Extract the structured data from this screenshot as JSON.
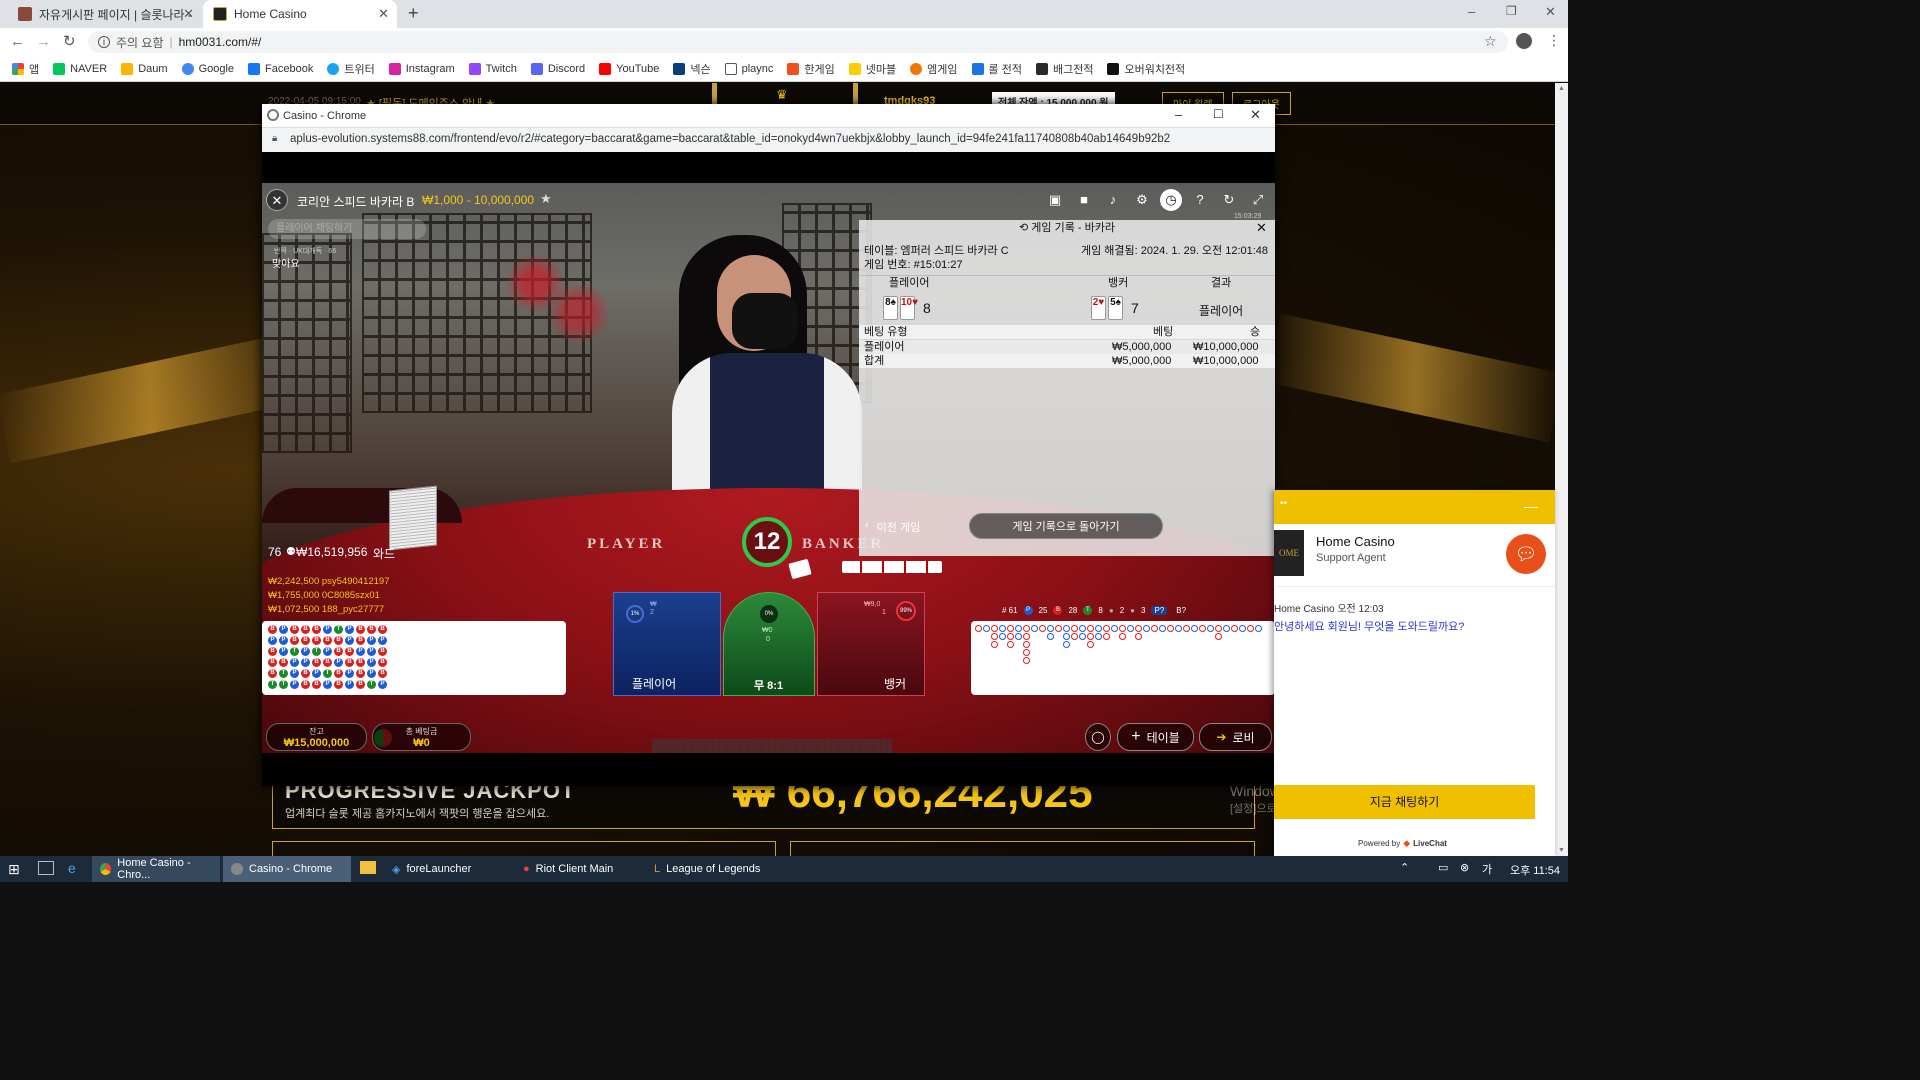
{
  "browser": {
    "tabs": [
      {
        "label": "자유게시판 페이지 | 슬롯나라 -",
        "active": false
      },
      {
        "label": "Home Casino",
        "active": true
      }
    ],
    "new_tab_glyph": "+",
    "address": {
      "warning": "주의 요함",
      "url": "hm0031.com/#/"
    },
    "bookmarks": [
      "앱",
      "NAVER",
      "Daum",
      "Google",
      "Facebook",
      "트위터",
      "Instagram",
      "Twitch",
      "Discord",
      "YouTube",
      "넥슨",
      "plaync",
      "한게임",
      "넷마블",
      "엠게임",
      "롤 전적",
      "배그전적",
      "오버워치전적"
    ]
  },
  "site_background": {
    "top_left_text": "2022-04-05 09:15:00",
    "notice": "★ [필독] 도메인주소 안내 ★",
    "user": "tmdgks93",
    "balance_label": "전체 잔액 : 15,000,000 원",
    "button1": "마이 월렛",
    "button2": "로그아웃",
    "banner_title": "PROGRESSIVE JACKPOT",
    "banner_sub": "업계최다 슬롯 제공 홈카지노에서 잭팟의 행운을 잡으세요.",
    "jackpot_value": "₩ 66,766,242,025",
    "watermark": "Windows 정품 인증",
    "watermark_sub": "[설정]으로 이동하여 Windows를 정품 인증합니다."
  },
  "popup": {
    "window_title": "Casino - Chrome",
    "url": "aplus-evolution.systems88.com/frontend/evo/r2/#category=baccarat&game=baccarat&table_id=onokyd4wn7uekbjx&lobby_launch_id=94fe241fa11740808b40ab14649b92b2"
  },
  "game": {
    "table_name": "코리안 스피드 바카라 B",
    "limits": "₩1,000 - 10,000,000",
    "chat_placeholder": "플레이어 채팅하기",
    "chat_meta": "반짝 · UK대개독 · 66",
    "chat_message": "맞아요",
    "time_small": "15:03:29",
    "players_count": "76",
    "total_wager": "₩16,519,956",
    "wager_suffix": "와드",
    "winners": [
      "₩2,242,500 psy5490412197",
      "₩1,755,000 0C8085szx01",
      "₩1,072,500 188_pyc27777"
    ],
    "timer": "12",
    "felt_player": "PLAYER",
    "felt_banker": "BANKER",
    "bet_spots": {
      "player": {
        "label": "플레이어",
        "pct": "1%",
        "players": "2",
        "amount": "₩"
      },
      "tie": {
        "label": "무 8:1",
        "pct": "0%",
        "amount": "₩0",
        "players": "0"
      },
      "banker": {
        "label": "뱅커",
        "pct": "99%",
        "amount": "₩9,0",
        "players": "1"
      }
    },
    "stats": {
      "games": "# 61",
      "player": "25",
      "banker": "28",
      "tie": "8",
      "player_pair": "2",
      "banker_pair": "3",
      "p_next": "P?",
      "b_next": "B?"
    },
    "balance_label": "잔고",
    "balance_value": "₩15,000,000",
    "total_bet_label": "총 베팅금",
    "total_bet_value": "₩0",
    "table_btn": "테이블",
    "lobby_btn": "로비"
  },
  "history": {
    "title": "게임 기록 - 바카라",
    "table_label": "테이블: 엠퍼러 스피드 바카라 C",
    "game_no": "게임 번호: #15:01:27",
    "resolved": "게임 해결됨: 2024. 1. 29. 오전 12:01:48",
    "col_player": "플레이어",
    "col_banker": "뱅커",
    "col_result": "결과",
    "player_cards": [
      "8♠",
      "10♥"
    ],
    "player_score": "8",
    "banker_cards": [
      "2♥",
      "5♠"
    ],
    "banker_score": "7",
    "result": "플레이어",
    "bet_headers": [
      "베팅 유형",
      "베팅",
      "승"
    ],
    "bet_rows": [
      {
        "type": "플레이어",
        "bet": "₩5,000,000",
        "win": "₩10,000,000"
      },
      {
        "type": "합계",
        "bet": "₩5,000,000",
        "win": "₩10,000,000"
      }
    ],
    "prev_btn": "이전 게임",
    "back_btn": "게임 기록으로 돌아가기"
  },
  "livechat": {
    "company": "Home Casino",
    "agent": "Support Agent",
    "msg_meta": "Home Casino 오전 12:03",
    "msg": "안녕하세요 회원님! 무엇을 도와드릴까요?",
    "button": "지금 채팅하기",
    "powered": "Powered by",
    "brand": "LiveChat"
  },
  "taskbar": {
    "items": [
      "Home Casino - Chro...",
      "Casino - Chrome",
      "foreLauncher",
      "Riot Client Main",
      "League of Legends"
    ],
    "clock": "오후 11:54"
  },
  "bead_road": [
    [
      "B",
      "P",
      "B",
      "B",
      "B",
      "P",
      "T",
      "P",
      "B",
      "B",
      "B"
    ],
    [
      "P",
      "P",
      "B",
      "B",
      "B",
      "B",
      "B",
      "P",
      "B",
      "P",
      "P"
    ],
    [
      "B",
      "P",
      "T",
      "P",
      "T",
      "P",
      "B",
      "B",
      "P",
      "P",
      "B"
    ],
    [
      "B",
      "B",
      "P",
      "P",
      "B",
      "B",
      "P",
      "B",
      "B",
      "P",
      "B"
    ],
    [
      "B",
      "T",
      "P",
      "B",
      "P",
      "T",
      "B",
      "P",
      "B",
      "P",
      "B"
    ],
    [
      "T",
      "T",
      "P",
      "B",
      "B",
      "P",
      "B",
      "P",
      "B",
      "T",
      "P"
    ]
  ],
  "colors": {
    "player": "#1e5bd8",
    "banker": "#d8201e",
    "tie": "#1a8a2a",
    "accent": "#f5c518"
  }
}
